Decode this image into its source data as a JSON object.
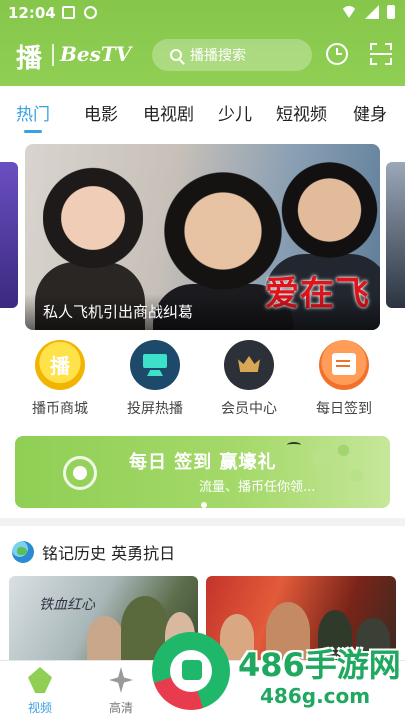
{
  "status_bar": {
    "time": "12:04"
  },
  "header": {
    "logo_text": "播",
    "brand": "BesTV",
    "search_placeholder": "播播搜索"
  },
  "tabs": [
    {
      "label": "热门",
      "active": true
    },
    {
      "label": "电影",
      "active": false
    },
    {
      "label": "电视剧",
      "active": false
    },
    {
      "label": "少儿",
      "active": false
    },
    {
      "label": "短视频",
      "active": false
    },
    {
      "label": "健身",
      "active": false
    }
  ],
  "banner": {
    "title": "爱在飞",
    "caption": "私人飞机引出商战纠葛"
  },
  "quick_menu": [
    {
      "label": "播币商城",
      "icon": "coin-icon",
      "icon_text": "播"
    },
    {
      "label": "投屏热播",
      "icon": "cast-icon"
    },
    {
      "label": "会员中心",
      "icon": "vip-crown-icon"
    },
    {
      "label": "每日签到",
      "icon": "calendar-icon"
    }
  ],
  "signin_banner": {
    "headline": "每日 签到 赢壕礼",
    "subline": "流量、播币任你领..."
  },
  "section": {
    "title": "铭记历史 英勇抗日",
    "icon": "globe-icon",
    "thumb1_text": "铁血红心"
  },
  "bottom_nav": [
    {
      "label": "视频",
      "active": true,
      "icon": "video-icon"
    },
    {
      "label": "高清",
      "active": false,
      "icon": "hd-icon"
    }
  ],
  "watermark": {
    "big": "486手游网",
    "small": "486g.com"
  },
  "colors": {
    "brand_green": "#8fcf54",
    "accent_blue": "#3aa0e0",
    "banner_title_red": "#e0121a"
  }
}
